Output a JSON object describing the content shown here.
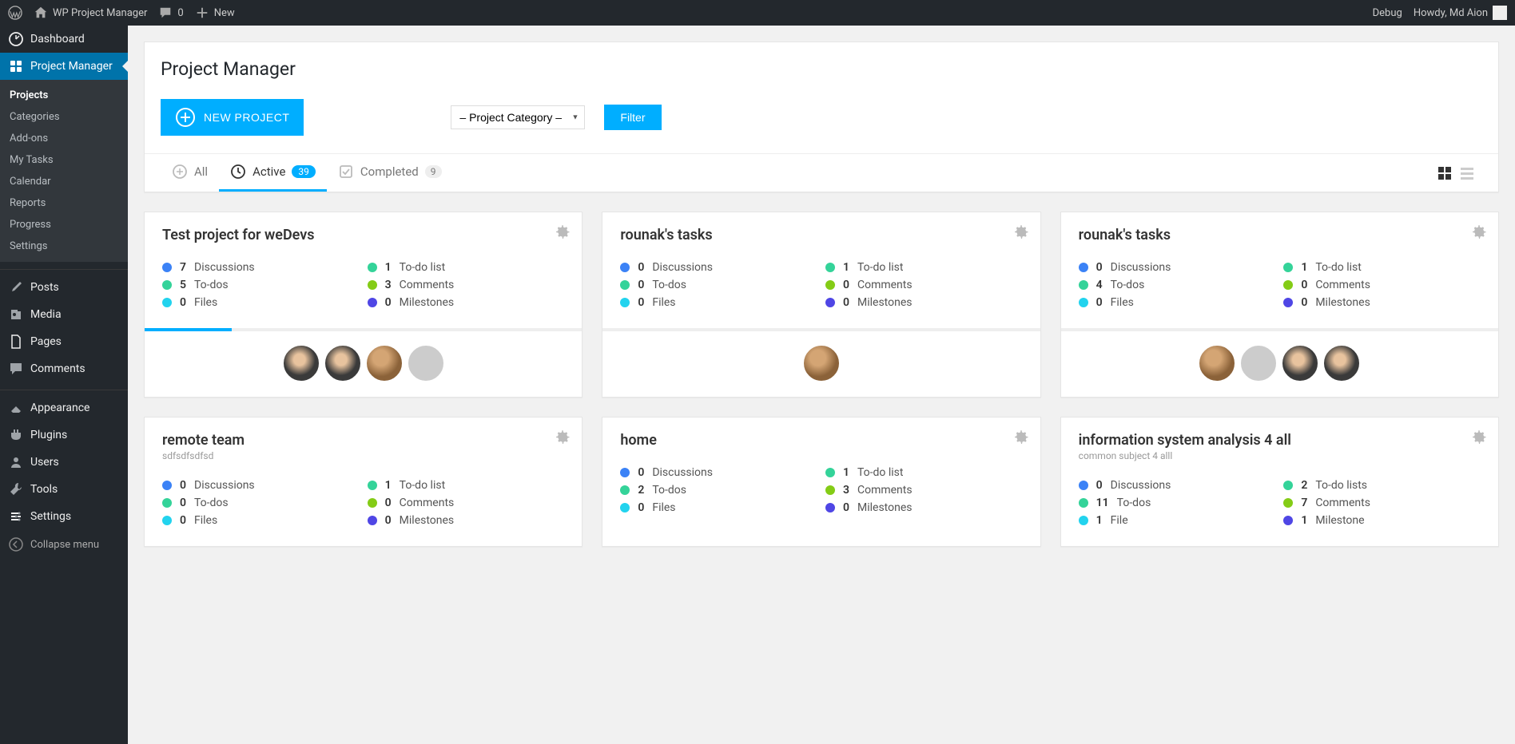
{
  "adminBar": {
    "siteName": "WP Project Manager",
    "comments": "0",
    "new": "New",
    "debug": "Debug",
    "howdy": "Howdy, Md Aion"
  },
  "sidebar": {
    "dashboard": "Dashboard",
    "projectManager": "Project Manager",
    "submenu": {
      "projects": "Projects",
      "categories": "Categories",
      "addons": "Add-ons",
      "myTasks": "My Tasks",
      "calendar": "Calendar",
      "reports": "Reports",
      "progress": "Progress",
      "settings": "Settings"
    },
    "posts": "Posts",
    "media": "Media",
    "pages": "Pages",
    "comments": "Comments",
    "appearance": "Appearance",
    "plugins": "Plugins",
    "users": "Users",
    "tools": "Tools",
    "settings": "Settings",
    "collapse": "Collapse menu"
  },
  "page": {
    "title": "Project Manager",
    "newProject": "NEW PROJECT",
    "categorySelect": "– Project Category –",
    "filter": "Filter"
  },
  "tabs": {
    "all": "All",
    "active": "Active",
    "activeCount": "39",
    "completed": "Completed",
    "completedCount": "9"
  },
  "labels": {
    "discussions": "Discussions",
    "todoList": "To-do list",
    "todoLists": "To-do lists",
    "todos": "To-dos",
    "comments": "Comments",
    "files": "Files",
    "file": "File",
    "milestones": "Milestones",
    "milestone": "Milestone"
  },
  "projects": [
    {
      "title": "Test project for weDevs",
      "subtitle": "",
      "discussions": "7",
      "todoList": "1",
      "todoListLabel": "todoList",
      "todos": "5",
      "comments": "3",
      "files": "0",
      "filesLabel": "files",
      "milestones": "0",
      "milestonesLabel": "milestones",
      "progress": 20,
      "avatars": [
        "f2",
        "f2",
        "f1",
        "grey"
      ]
    },
    {
      "title": "rounak's tasks",
      "subtitle": "",
      "discussions": "0",
      "todoList": "1",
      "todoListLabel": "todoList",
      "todos": "0",
      "comments": "0",
      "files": "0",
      "filesLabel": "files",
      "milestones": "0",
      "milestonesLabel": "milestones",
      "progress": 0,
      "avatars": [
        "f1"
      ]
    },
    {
      "title": "rounak's tasks",
      "subtitle": "",
      "discussions": "0",
      "todoList": "1",
      "todoListLabel": "todoList",
      "todos": "4",
      "comments": "0",
      "files": "0",
      "filesLabel": "files",
      "milestones": "0",
      "milestonesLabel": "milestones",
      "progress": 0,
      "avatars": [
        "f1",
        "grey",
        "f2",
        "f2"
      ]
    },
    {
      "title": "remote team",
      "subtitle": "sdfsdfsdfsd",
      "discussions": "0",
      "todoList": "1",
      "todoListLabel": "todoList",
      "todos": "0",
      "comments": "0",
      "files": "0",
      "filesLabel": "files",
      "milestones": "0",
      "milestonesLabel": "milestones",
      "progress": 0,
      "avatars": []
    },
    {
      "title": "home",
      "subtitle": "",
      "discussions": "0",
      "todoList": "1",
      "todoListLabel": "todoList",
      "todos": "2",
      "comments": "3",
      "files": "0",
      "filesLabel": "files",
      "milestones": "0",
      "milestonesLabel": "milestones",
      "progress": 0,
      "avatars": []
    },
    {
      "title": "information system analysis 4 all",
      "subtitle": "common subject 4 alll",
      "discussions": "0",
      "todoList": "2",
      "todoListLabel": "todoLists",
      "todos": "11",
      "comments": "7",
      "files": "1",
      "filesLabel": "file",
      "milestones": "1",
      "milestonesLabel": "milestone",
      "progress": 0,
      "avatars": []
    }
  ]
}
